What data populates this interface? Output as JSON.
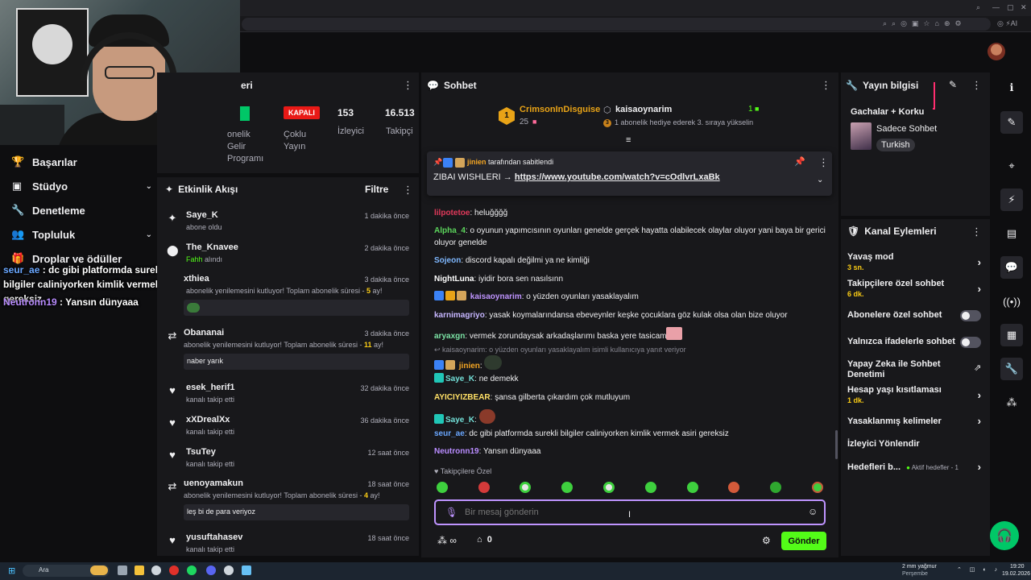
{
  "browser": {
    "window_controls": [
      "—",
      "▢",
      "✕"
    ]
  },
  "stats": {
    "section_title_fragment": "eri",
    "status_badge": "KAPALI",
    "label_affiliate": "Abonelik Gelir Programı",
    "label_affiliate_line1": "oneli‌k",
    "label_affiliate_line2": "Gelir",
    "label_affiliate_line3": "Programı",
    "label_multi_stream_1": "Çoklu",
    "label_multi_stream_2": "Yayın",
    "viewers_count": "153",
    "viewers_label": "İzleyici",
    "followers_count": "16.513",
    "followers_label": "Takipçi"
  },
  "leftnav": {
    "items": [
      {
        "label": "Başarılar",
        "icon": "trophy-icon"
      },
      {
        "label": "Stüdyo",
        "icon": "studio-icon"
      },
      {
        "label": "Denetleme",
        "icon": "wrench-icon"
      },
      {
        "label": "Topluluk",
        "icon": "community-icon"
      },
      {
        "label": "Droplar ve ödüller",
        "icon": "gift-icon"
      }
    ],
    "overlay_chat": [
      {
        "user": "seur_ae",
        "text": " : dc gibi platformda surekli bilgiler caliniyorken kimlik vermek asiri gereksiz",
        "color": "#6aa7ff"
      },
      {
        "user": "Neutronn19",
        "text": " : Yansın dünyaaa",
        "color": "#b98cff"
      }
    ]
  },
  "feed": {
    "title": "Etkinlik Akışı",
    "filter_label": "Filtre",
    "items": [
      {
        "name": "Saye_K",
        "sub": "abone oldu",
        "time": "1 dakika önce",
        "icon": "sparkle-icon"
      },
      {
        "name": "The_Knavee",
        "sub_prefix": "Fahh",
        "sub": " alındı",
        "time": "2 dakika önce",
        "icon": "redeem-icon"
      },
      {
        "name": "xthiea",
        "sub": "abonelik yenilemesini kutluyor! Toplam abonelik süresi - ",
        "months": "5",
        "months_suffix": " ay!",
        "time": "3 dakika önce",
        "icon": "resub-icon"
      },
      {
        "name": "Obananai",
        "sub": "abonelik yenilemesini kutluyor! Toplam abonelik süresi - ",
        "months": "11",
        "months_suffix": " ay!",
        "message": "naber yarık",
        "time": "3 dakika önce",
        "icon": "resub-icon"
      },
      {
        "name": "esek_herif1",
        "sub": "kanalı takip etti",
        "time": "32 dakika önce",
        "icon": "heart-icon"
      },
      {
        "name": "xXDrealXx",
        "sub": "kanalı takip etti",
        "time": "36 dakika önce",
        "icon": "heart-icon"
      },
      {
        "name": "TsuTey",
        "sub": "kanalı takip etti",
        "time": "12 saat önce",
        "icon": "heart-icon"
      },
      {
        "name": "uenoyamakun",
        "sub": "abonelik yenilemesini kutluyor! Toplam abonelik süresi - ",
        "months": "4",
        "months_suffix": " ay!",
        "message": "leş bi de para veriyoz",
        "time": "18 saat önce",
        "icon": "resub-icon"
      },
      {
        "name": "yusuftahasev",
        "sub": "kanalı takip etti",
        "time": "18 saat önce",
        "icon": "heart-icon"
      }
    ]
  },
  "chat": {
    "title": "Sohbet",
    "leaderboard": {
      "first_name": "CrimsonInDisguise",
      "first_rank": "1",
      "first_count": "25",
      "gift_user": "kaisaoynarim",
      "gift_count": "1",
      "gift_rank": "3",
      "gift_text": "1 abonelik hediye ederek 3. sıraya yükselin"
    },
    "pinned": {
      "pinned_by_user": "jinien",
      "pinned_by_text": " tarafından sabitlendi",
      "text_prefix": "ZIBAI WISHLERI → ",
      "link": "https://www.youtube.com/watch?v=cOdlvrLxaBk"
    },
    "messages": [
      {
        "user": "lilpotetoe",
        "text": ": heluğğğğ",
        "color": "#e0395a"
      },
      {
        "user": "Alpha_4",
        "text": ": o oyunun yapımcısının oyunları genelde gerçek hayatta olabilecek olaylar oluyor yani baya bir gerici oluyor genelde",
        "color": "#5cd65c"
      },
      {
        "user": "Sojeon",
        "text": ": discord kapalı değilmi ya ne kimliği",
        "color": "#7fb8ff"
      },
      {
        "user": "NightLuna",
        "text": ": iyidir bora sen nasılsınn",
        "color": "#ffffff"
      },
      {
        "user": "kaisaoynarim",
        "text": ": o yüzden oyunları yasaklayalım",
        "color": "#bf94ff"
      },
      {
        "user": "karnimagriyo",
        "text": ": yasak koymalarındansa ebeveynler keşke çocuklara göz kulak olsa olan bize oluyor",
        "color": "#c6b6ff"
      },
      {
        "user": "aryaxgn",
        "text": ": vermek zorundaysak arkadaşlarımı baska yere tasicam",
        "color": "#7be3a5"
      },
      {
        "user": "jinien",
        "text": ":",
        "color": "#f5a623"
      },
      {
        "user": "Saye_K",
        "text": ": ne demekk",
        "color": "#73e0d8"
      },
      {
        "user": "AYICIYIZBEAR",
        "text": ": şansa gilberta çıkardım çok mutluyum",
        "color": "#ffe066"
      },
      {
        "user": "Saye_K",
        "text": ":",
        "color": "#73e0d8"
      },
      {
        "user": "seur_ae",
        "text": ": dc gibi platformda surekli bilgiler caliniyorken kimlik vermek asiri gereksiz",
        "color": "#6aa7ff"
      },
      {
        "user": "Neutronn19",
        "text": ": Yansın dünyaaa",
        "color": "#b98cff"
      }
    ],
    "reply_reference": "kaisaoynarim: o yüzden oyunları yasaklayalım isimli kullanıcıya yanıt veriyor",
    "followers_only_label": "Takipçilere Özel",
    "input_placeholder": "Bir mesaj gönderin",
    "points_label": "∞",
    "chest_count": "0",
    "send_label": "Gönder"
  },
  "info": {
    "title": "Yayın bilgisi",
    "stream_title": "Gachalar + Korku",
    "category": "Sadece Sohbet",
    "language_tag": "Turkish"
  },
  "actions": {
    "title": "Kanal Eylemleri",
    "items": [
      {
        "label": "Yavaş mod",
        "sub": "3 sn.",
        "control": "chevron"
      },
      {
        "label": "Takipçilere özel sohbet",
        "sub": "6 dk.",
        "control": "chevron"
      },
      {
        "label": "Abonelere özel sohbet",
        "sub": "",
        "control": "toggle"
      },
      {
        "label": "Yalnızca ifadelerle sohbet",
        "sub": "",
        "control": "toggle"
      },
      {
        "label": "Yapay Zeka ile Sohbet Denetimi",
        "sub": "",
        "control": "external"
      },
      {
        "label": "Hesap yaşı kısıtlaması",
        "sub": "1 dk.",
        "control": "chevron"
      },
      {
        "label": "Yasaklanmış kelimeler",
        "sub": "",
        "control": "chevron"
      },
      {
        "label": "İzleyici Yönlendir",
        "sub": "",
        "control": "none"
      },
      {
        "label": "Hedefleri b...",
        "sub": "",
        "control": "chevron",
        "extra": "Aktif hedefler - 1"
      }
    ]
  },
  "taskbar": {
    "search_placeholder": "Ara",
    "weather": "2 mm yağmur",
    "weather_day": "Perşembe",
    "time": "19:20",
    "date": "19.02.2026"
  }
}
